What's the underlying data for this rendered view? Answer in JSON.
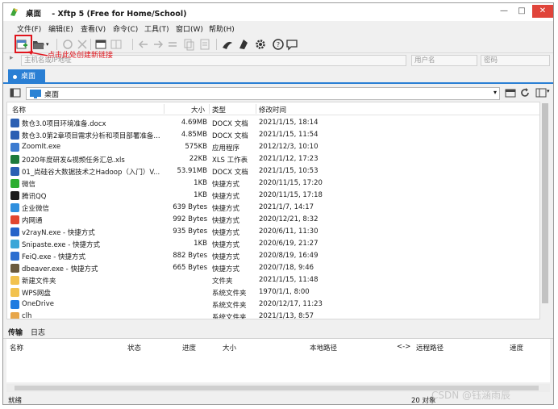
{
  "window": {
    "title": "桌面    - Xftp 5 (Free for Home/School)",
    "minimize": "—",
    "maximize": "□",
    "close": "✕"
  },
  "menu": [
    "文件(F)",
    "编辑(E)",
    "查看(V)",
    "命令(C)",
    "工具(T)",
    "窗口(W)",
    "帮助(H)"
  ],
  "address": {
    "host_placeholder": "主机名或IP地址",
    "user_placeholder": "用户名",
    "password_placeholder": "密码"
  },
  "annotation": "点击此处创建新链接",
  "tab": {
    "label": "桌面"
  },
  "path": {
    "current": "桌面"
  },
  "columns": {
    "name": "名称",
    "size": "大小",
    "type": "类型",
    "modified": "修改时间"
  },
  "files": [
    {
      "name": "数仓3.0项目环境准备.docx",
      "size": "4.69MB",
      "type": "DOCX 文档",
      "date": "2021/1/15, 18:14",
      "icon": "word-icon",
      "color": "#2b5fb3"
    },
    {
      "name": "数仓3.0第2章项目需求分析和项目部署准备...",
      "size": "4.85MB",
      "type": "DOCX 文档",
      "date": "2021/1/15, 11:54",
      "icon": "word-icon",
      "color": "#2b5fb3"
    },
    {
      "name": "ZoomIt.exe",
      "size": "575KB",
      "type": "应用程序",
      "date": "2012/12/3, 10:10",
      "icon": "zoomit-icon",
      "color": "#3c7bd0"
    },
    {
      "name": "2020年度研发&视频任务汇总.xls",
      "size": "22KB",
      "type": "XLS 工作表",
      "date": "2021/1/12, 17:23",
      "icon": "excel-icon",
      "color": "#1e7a3c"
    },
    {
      "name": "01_尚硅谷大数据技术之Hadoop（入门）V...",
      "size": "53.91MB",
      "type": "DOCX 文档",
      "date": "2021/1/15, 10:53",
      "icon": "word-icon",
      "color": "#2b5fb3"
    },
    {
      "name": "微信",
      "size": "1KB",
      "type": "快捷方式",
      "date": "2020/11/15, 17:20",
      "icon": "wechat-icon",
      "color": "#2bae2f"
    },
    {
      "name": "腾讯QQ",
      "size": "1KB",
      "type": "快捷方式",
      "date": "2020/11/15, 17:18",
      "icon": "qq-icon",
      "color": "#1c1c1c"
    },
    {
      "name": "企业微信",
      "size": "639 Bytes",
      "type": "快捷方式",
      "date": "2021/1/7, 14:17",
      "icon": "wecom-icon",
      "color": "#2f8fde"
    },
    {
      "name": "内网通",
      "size": "992 Bytes",
      "type": "快捷方式",
      "date": "2020/12/21, 8:32",
      "icon": "neiwangtong-icon",
      "color": "#e2462f"
    },
    {
      "name": "v2rayN.exe - 快捷方式",
      "size": "935 Bytes",
      "type": "快捷方式",
      "date": "2020/6/11, 11:30",
      "icon": "v2rayn-icon",
      "color": "#2563c9"
    },
    {
      "name": "Snipaste.exe - 快捷方式",
      "size": "1KB",
      "type": "快捷方式",
      "date": "2020/6/19, 21:27",
      "icon": "snipaste-icon",
      "color": "#3aa6d8"
    },
    {
      "name": "FeiQ.exe - 快捷方式",
      "size": "882 Bytes",
      "type": "快捷方式",
      "date": "2020/8/19, 16:49",
      "icon": "feiq-icon",
      "color": "#2d6fd0"
    },
    {
      "name": "dbeaver.exe - 快捷方式",
      "size": "665 Bytes",
      "type": "快捷方式",
      "date": "2020/7/18, 9:46",
      "icon": "dbeaver-icon",
      "color": "#6b5a3e"
    },
    {
      "name": "新建文件夹",
      "size": "",
      "type": "文件夹",
      "date": "2021/1/15, 11:48",
      "icon": "folder-icon",
      "color": "#f2c24e"
    },
    {
      "name": "WPS网盘",
      "size": "",
      "type": "系统文件夹",
      "date": "1970/1/1, 8:00",
      "icon": "wps-cloud-icon",
      "color": "#f2c24e"
    },
    {
      "name": "OneDrive",
      "size": "",
      "type": "系统文件夹",
      "date": "2020/12/17, 11:23",
      "icon": "onedrive-icon",
      "color": "#1f7be0"
    },
    {
      "name": "clh",
      "size": "",
      "type": "系统文件夹",
      "date": "2021/1/13, 8:57",
      "icon": "user-folder-icon",
      "color": "#e7a64a"
    }
  ],
  "transfer": {
    "tabs": [
      "传输",
      "日志"
    ],
    "columns": [
      "名称",
      "状态",
      "进度",
      "大小",
      "本地路径",
      "<->",
      "远程路径",
      "速度"
    ]
  },
  "status": {
    "left": "就绪",
    "count": "20 对象"
  },
  "watermark": "CSDN @钰涵雨辰"
}
